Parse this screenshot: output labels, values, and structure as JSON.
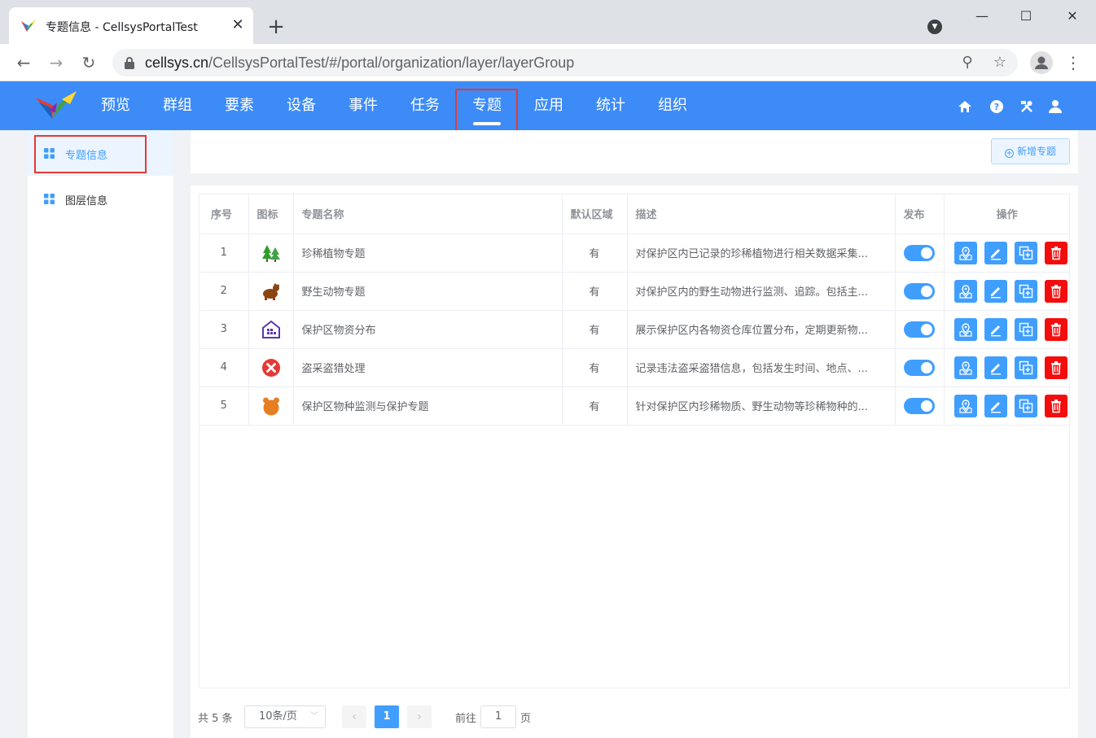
{
  "browser": {
    "tab_title": "专题信息 - CellsysPortalTest",
    "tab_close": "✕",
    "new_tab": "+",
    "url_host": "cellsys.cn",
    "url_path": "/CellsysPortalTest/#/portal/organization/layer/layerGroup"
  },
  "nav": {
    "items": [
      "预览",
      "群组",
      "要素",
      "设备",
      "事件",
      "任务",
      "专题",
      "应用",
      "统计",
      "组织"
    ],
    "active_index": 6
  },
  "sidebar": {
    "items": [
      "专题信息",
      "图层信息"
    ],
    "active_index": 0
  },
  "toolbar": {
    "add_label": "新增专题"
  },
  "table": {
    "headers": [
      "序号",
      "图标",
      "专题名称",
      "默认区域",
      "描述",
      "发布",
      "操作"
    ],
    "rows": [
      {
        "index": "1",
        "icon": "tree-icon",
        "name": "珍稀植物专题",
        "region": "有",
        "desc": "对保护区内已记录的珍稀植物进行相关数据采集...",
        "published": true
      },
      {
        "index": "2",
        "icon": "animal-icon",
        "name": "野生动物专题",
        "region": "有",
        "desc": "对保护区内的野生动物进行监测、追踪。包括主...",
        "published": true
      },
      {
        "index": "3",
        "icon": "warehouse-icon",
        "name": "保护区物资分布",
        "region": "有",
        "desc": "展示保护区内各物资仓库位置分布，定期更新物...",
        "published": true
      },
      {
        "index": "4",
        "icon": "prohibited-icon",
        "name": "盗采盗猎处理",
        "region": "有",
        "desc": "记录违法盗采盗猎信息，包括发生时间、地点、...",
        "published": true
      },
      {
        "index": "5",
        "icon": "bear-icon",
        "name": "保护区物种监测与保护专题",
        "region": "有",
        "desc": "针对保护区内珍稀物质、野生动物等珍稀物种的...",
        "published": true
      }
    ]
  },
  "pagination": {
    "total": "共 5 条",
    "page_size": "10条/页",
    "current_page": "1",
    "goto_label": "前往",
    "goto_value": "1",
    "page_label": "页"
  },
  "colors": {
    "header_bg": "#3d8bf7",
    "primary": "#409eff",
    "danger": "#f40d0d",
    "highlight": "#e53935"
  }
}
